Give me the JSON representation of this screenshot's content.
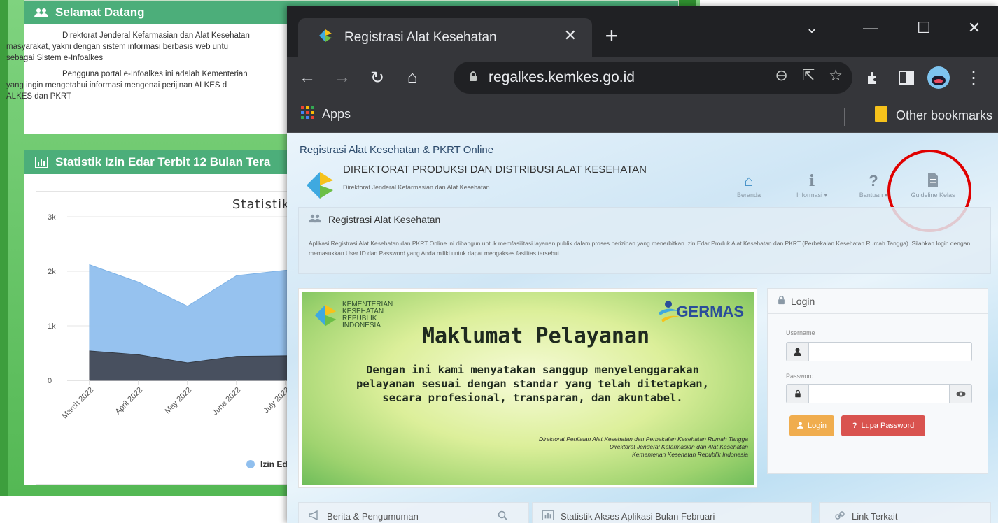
{
  "background_page": {
    "welcome": {
      "title": "Selamat Datang",
      "paragraph1": "Direktorat Jenderal Kefarmasian dan Alat Kesehatan",
      "paragraph1_cont": "masyarakat, yakni dengan sistem informasi berbasis web untu",
      "paragraph1_end": "sebagai Sistem e-Infoalkes",
      "paragraph2": "Pengguna portal e-Infoalkes ini adalah Kementerian",
      "paragraph2_cont": "yang ingin mengetahui informasi mengenai perijinan ALKES d",
      "paragraph2_end": "ALKES dan PKRT"
    },
    "stats_panel": {
      "title": "Statistik Izin Edar Terbit 12 Bulan Tera"
    },
    "chart_data": {
      "type": "area",
      "title": "Statistik Izi",
      "x": [
        "March 2022",
        "April 2022",
        "May 2022",
        "June 2022",
        "July 2022"
      ],
      "series": [
        {
          "name": "Izin Ed",
          "values": [
            2120,
            1800,
            1360,
            1920,
            2020
          ],
          "color": "#90bfee"
        },
        {
          "values": [
            540,
            470,
            320,
            440,
            450
          ],
          "color": "#434a56"
        }
      ],
      "yticks": [
        "0",
        "1k",
        "2k",
        "3k"
      ],
      "ylim": [
        0,
        3000
      ],
      "grid": true,
      "legend_position": "bottom"
    }
  },
  "browser": {
    "tab_title": "Registrasi Alat Kesehatan",
    "new_tab_symbol": "+",
    "url": "regalkes.kemkes.go.id",
    "bookmarks": {
      "apps": "Apps",
      "other": "Other bookmarks"
    },
    "window_controls": {
      "dropdown": "⌄",
      "minimize": "—",
      "maximize": "☐",
      "close": "✕"
    }
  },
  "site": {
    "top_title": "Registrasi Alat Kesehatan & PKRT Online",
    "brand_name": "DIREKTORAT PRODUKSI DAN DISTRIBUSI ALAT KESEHATAN",
    "brand_sub": "Direktorat Jenderal Kefarmasian dan Alat Kesehatan",
    "nav": {
      "beranda": "Beranda",
      "informasi": "Informasi ▾",
      "bantuan": "Bantuan ▾",
      "guideline": "Guideline Kelas"
    },
    "registration": {
      "title": "Registrasi Alat Kesehatan",
      "description": "Aplikasi Registrasi Alat Kesehatan dan PKRT Online ini dibangun untuk memfasilitasi layanan publik dalam proses perizinan yang menerbitkan Izin Edar Produk Alat Kesehatan dan PKRT (Perbekalan Kesehatan Rumah Tangga). Silahkan login dengan memasukkan User ID dan Password yang Anda miliki untuk dapat mengakses fasilitas tersebut."
    },
    "banner": {
      "kementerian": [
        "KEMENTERIAN",
        "KESEHATAN",
        "REPUBLIK",
        "INDONESIA"
      ],
      "germas": "GERMAS",
      "title": "Maklumat Pelayanan",
      "message": [
        "Dengan ini kami menyatakan sanggup menyelenggarakan",
        "pelayanan sesuai dengan standar yang telah ditetapkan,",
        "secara profesional, transparan, dan akuntabel."
      ],
      "signature": [
        "Direktorat Penilaian Alat Kesehatan dan Perbekalan Kesehatan Rumah Tangga",
        "Direktorat Jenderal Kefarmasian dan Alat Kesehatan",
        "Kementerian Kesehatan Republik Indonesia"
      ]
    },
    "login": {
      "title": "Login",
      "username_label": "Username",
      "password_label": "Password",
      "login_button": "Login",
      "forgot_button": "Lupa Password"
    },
    "bottom": {
      "news": "Berita & Pengumuman",
      "stats": "Statistik Akses Aplikasi Bulan Februari",
      "links": "Link Terkait"
    }
  }
}
